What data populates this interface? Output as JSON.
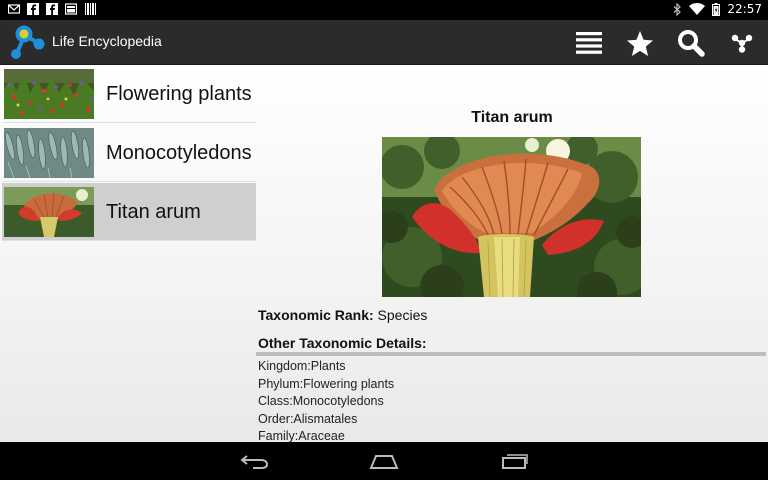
{
  "status_bar": {
    "time": "22:57",
    "left_icons": [
      "gmail-icon",
      "facebook-icon",
      "facebook-icon",
      "gallery-icon",
      "barcode-icon"
    ],
    "right_icons": [
      "bluetooth-icon",
      "wifi-icon",
      "battery-icon"
    ]
  },
  "action_bar": {
    "title": "Life Encyclopedia",
    "actions": [
      "list-icon",
      "star-icon",
      "search-icon",
      "tree-icon"
    ]
  },
  "list": {
    "items": [
      {
        "label": "Flowering plants",
        "selected": false
      },
      {
        "label": "Monocotyledons",
        "selected": false
      },
      {
        "label": "Titan arum",
        "selected": true
      }
    ]
  },
  "detail": {
    "title": "Titan arum",
    "rank_label": "Taxonomic Rank:",
    "rank_value": "Species",
    "other_heading": "Other Taxonomic Details:",
    "taxonomy": [
      "Kingdom:Plants",
      "Phylum:Flowering plants",
      "Class:Monocotyledons",
      "Order:Alismatales",
      "Family:Araceae"
    ]
  },
  "colors": {
    "action_bar": "#2b2b2b",
    "selected_item": "#cfcfcf",
    "logo_blue": "#1e8fd8",
    "logo_yellow": "#d4d12a"
  }
}
